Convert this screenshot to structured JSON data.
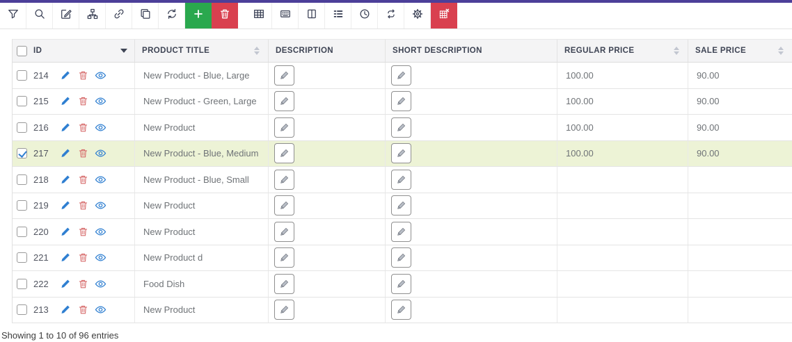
{
  "colors": {
    "topbar": "#4c3f99",
    "add_button_green": "#2aa84e",
    "delete_button_red": "#d9404f",
    "selected_row": "#edf3d6"
  },
  "toolbar": {
    "icons": [
      "filter",
      "search",
      "bulk-edit",
      "sitemap",
      "link",
      "duplicate",
      "refresh",
      "add-new",
      "delete-selected",
      "table",
      "keyboard-shortcuts",
      "columns",
      "list-view",
      "history",
      "sync",
      "settings",
      "clear-table"
    ]
  },
  "table": {
    "columns": [
      {
        "label": "ID",
        "sort": "desc"
      },
      {
        "label": "PRODUCT TITLE",
        "sort": "both"
      },
      {
        "label": "DESCRIPTION",
        "sort": "none"
      },
      {
        "label": "SHORT DESCRIPTION",
        "sort": "none"
      },
      {
        "label": "REGULAR PRICE",
        "sort": "both"
      },
      {
        "label": "SALE PRICE",
        "sort": "both"
      }
    ],
    "rows": [
      {
        "id": "214",
        "title": "New Product - Blue, Large",
        "regular_price": "100.00",
        "sale_price": "90.00",
        "selected": false
      },
      {
        "id": "215",
        "title": "New Product - Green, Large",
        "regular_price": "100.00",
        "sale_price": "90.00",
        "selected": false
      },
      {
        "id": "216",
        "title": "New Product",
        "regular_price": "100.00",
        "sale_price": "90.00",
        "selected": false
      },
      {
        "id": "217",
        "title": "New Product - Blue, Medium",
        "regular_price": "100.00",
        "sale_price": "90.00",
        "selected": true
      },
      {
        "id": "218",
        "title": "New Product - Blue, Small",
        "regular_price": "",
        "sale_price": "",
        "selected": false
      },
      {
        "id": "219",
        "title": "New Product",
        "regular_price": "",
        "sale_price": "",
        "selected": false
      },
      {
        "id": "220",
        "title": "New Product",
        "regular_price": "",
        "sale_price": "",
        "selected": false
      },
      {
        "id": "221",
        "title": "New Product d",
        "regular_price": "",
        "sale_price": "",
        "selected": false
      },
      {
        "id": "222",
        "title": "Food Dish",
        "regular_price": "",
        "sale_price": "",
        "selected": false
      },
      {
        "id": "213",
        "title": "New Product",
        "regular_price": "",
        "sale_price": "",
        "selected": false
      }
    ]
  },
  "footer": {
    "summary": "Showing 1 to 10 of 96 entries"
  }
}
